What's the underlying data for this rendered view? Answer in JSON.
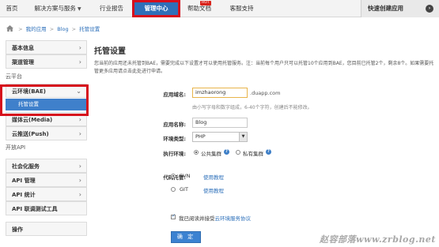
{
  "nav": {
    "items": [
      {
        "label": "首页"
      },
      {
        "label": "解决方案与服务",
        "caret": "▼"
      },
      {
        "label": "行业报告"
      },
      {
        "label": "管理中心"
      },
      {
        "label": "帮助文档",
        "badge": "HOT"
      },
      {
        "label": "客服支持"
      }
    ],
    "quick_create": "快速创建应用",
    "quick_create_icon": "right-arrow-circle-icon"
  },
  "breadcrumb": {
    "items": [
      "我的应用",
      "Blog",
      "托管设置"
    ],
    "separator": ">"
  },
  "sidebar": {
    "top_items": [
      {
        "label": "基本信息",
        "arrow": "›"
      },
      {
        "label": "渠道管理",
        "arrow": "›"
      }
    ],
    "group_cloud": "云平台",
    "cloud_items": [
      {
        "label": "云环境(BAE)",
        "arrow": "⌄"
      },
      {
        "label": "托管设置"
      },
      {
        "label": "媒体云(Media)",
        "arrow": "›"
      },
      {
        "label": "云推送(Push)",
        "arrow": "›"
      }
    ],
    "group_open": "开放API",
    "open_items": [
      {
        "label": "社会化服务",
        "arrow": "›"
      },
      {
        "label": "API 管理",
        "arrow": "›"
      },
      {
        "label": "API 统计",
        "arrow": "›"
      },
      {
        "label": "API 联调测试工具"
      }
    ],
    "ops": "操作"
  },
  "main": {
    "title": "托管设置",
    "intro": "您当前的应用还未托管到BAE，需要完成以下设置才可以使用托管服务。注：当前每个用户只可以托管10个应用到BAE，您目前已托管2个，剩余8个。如果需要托管更多应用请点击此处进行申请。",
    "domain_label": "应用域名:",
    "domain_value": "imzhaorong",
    "domain_suffix": ".duapp.com",
    "domain_hint": "由小写字母和数字组成，6-40个字符，创建后不能修改。",
    "name_label": "应用名称:",
    "name_value": "Blog",
    "env_label": "环境类型:",
    "env_value": "PHP",
    "exec_label": "执行环境:",
    "exec_public": "公共集群",
    "exec_private": "私有集群",
    "help_mark": "?",
    "vcs_label": "代码托管:",
    "vcs_svn": "SVN",
    "vcs_git": "GIT",
    "usage_link": "使用教程",
    "agree_text": "我已阅读并接受",
    "agree_link": "云环境服务协议",
    "submit": "确 定"
  },
  "watermark": "赵容部落www.zrblog.net",
  "colors": {
    "accent": "#2f6fb8",
    "highlight": "#d60f1c",
    "link": "#2a6eb9"
  }
}
